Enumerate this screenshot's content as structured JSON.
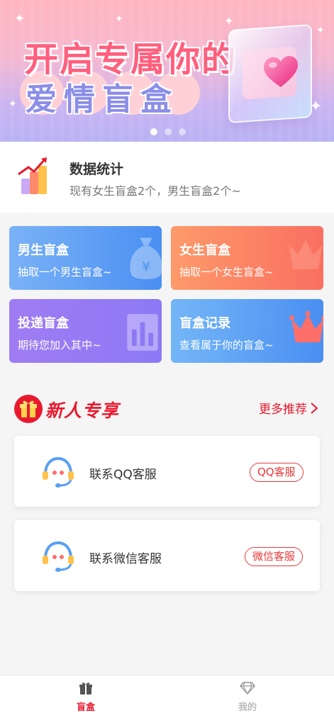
{
  "banner": {
    "line1": "开启专属你的",
    "line2": "爱情盲盒",
    "slide_count": 3,
    "active_slide": 1
  },
  "stats": {
    "title": "数据统计",
    "description": "现有女生盲盒2个，男生盲盒2个~"
  },
  "cards": {
    "male": {
      "title": "男生盲盒",
      "desc": "抽取一个男生盲盒~"
    },
    "female": {
      "title": "女生盲盒",
      "desc": "抽取一个女生盲盒~"
    },
    "deliver": {
      "title": "投递盲盒",
      "desc": "期待您加入其中~"
    },
    "record": {
      "title": "盲盒记录",
      "desc": "查看属于你的盲盒~"
    }
  },
  "newcomer": {
    "title": "新人专享",
    "more_label": "更多推荐"
  },
  "services": {
    "qq": {
      "label": "联系QQ客服",
      "button": "QQ客服"
    },
    "wechat": {
      "label": "联系微信客服",
      "button": "微信客服"
    }
  },
  "bottom_nav": {
    "blindbox": "盲盒",
    "mine": "我的"
  },
  "colors": {
    "accent": "#e8192e",
    "male_card": "#4a8ff2",
    "female_card": "#fa6f60",
    "deliver_card": "#8c79f5",
    "record_card": "#4a8ff2"
  }
}
